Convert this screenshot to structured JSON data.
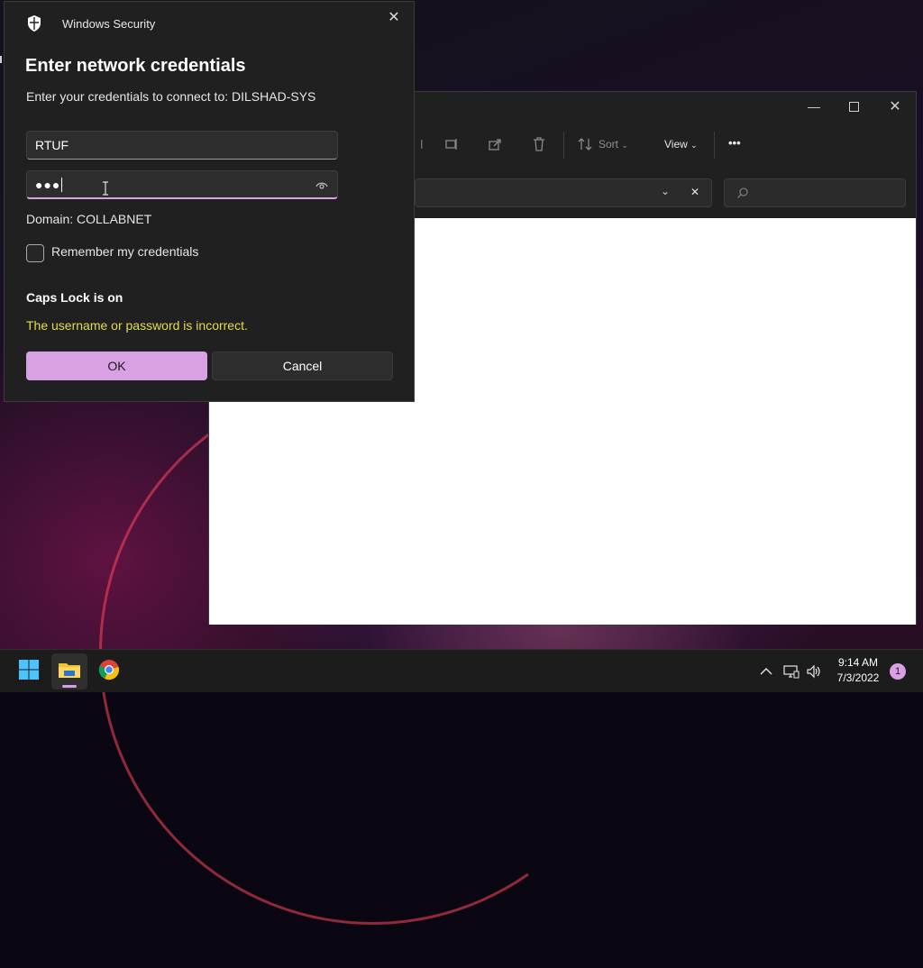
{
  "dialog": {
    "app_name": "Windows Security",
    "title": "Enter network credentials",
    "subtitle": "Enter your credentials to connect to: DILSHAD-SYS",
    "username_value": "RTUF",
    "password_mask": "●●●",
    "domain_text": "Domain: COLLABNET",
    "remember_label": "Remember my credentials",
    "remember_checked": false,
    "caps_lock_text": "Caps Lock is on",
    "error_text": "The username or password is incorrect.",
    "ok_label": "OK",
    "cancel_label": "Cancel",
    "accent_color": "#d9a0e3",
    "error_color": "#e6dc4b"
  },
  "explorer": {
    "toolbar": {
      "sort_label": "Sort",
      "view_label": "View",
      "more_label": "•••",
      "icons": [
        "rename-icon",
        "share-icon",
        "delete-icon",
        "sort-icon"
      ]
    },
    "window_controls": [
      "minimize",
      "maximize",
      "close"
    ]
  },
  "taskbar": {
    "apps": [
      "start",
      "file-explorer",
      "chrome"
    ],
    "active_app": "file-explorer",
    "time": "9:14 AM",
    "date": "7/3/2022",
    "notification_count": "1"
  }
}
